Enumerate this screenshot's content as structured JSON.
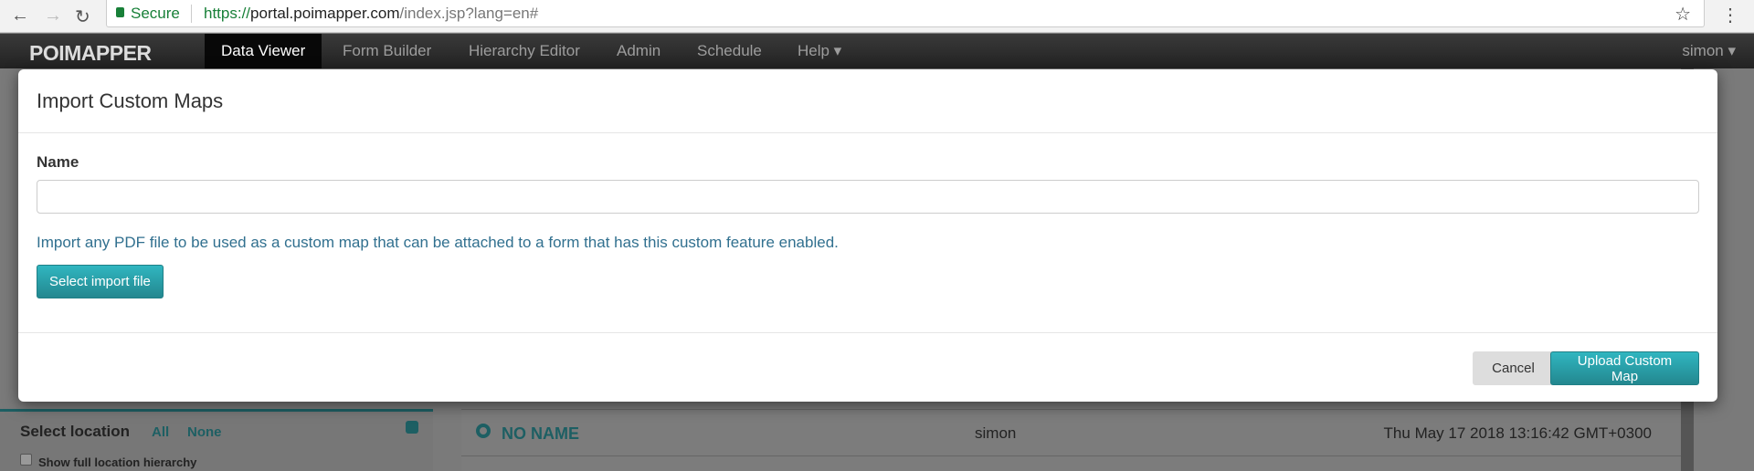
{
  "browser": {
    "secure_label": "Secure",
    "url_scheme": "https://",
    "url_host": "portal.poimapper.com",
    "url_path": "/index.jsp?lang=en#"
  },
  "navbar": {
    "logo": "POIMAPPER",
    "items": [
      {
        "label": "Data Viewer",
        "active": true
      },
      {
        "label": "Form Builder"
      },
      {
        "label": "Hierarchy Editor"
      },
      {
        "label": "Admin"
      },
      {
        "label": "Schedule"
      },
      {
        "label": "Help ▾"
      }
    ],
    "user": "simon ▾"
  },
  "modal": {
    "title": "Import Custom Maps",
    "name_label": "Name",
    "name_value": "",
    "help_text": "Import any PDF file to be used as a custom map that can be attached to a form that has this custom feature enabled.",
    "select_file": "Select import file",
    "cancel": "Cancel",
    "upload": "Upload Custom Map"
  },
  "sidebar": {
    "title": "Select location",
    "all": "All",
    "none": "None",
    "show_full": "Show full location hierarchy"
  },
  "list": {
    "rows": [
      {
        "name": "NO NAME",
        "user": "simon",
        "date": "Thu May 17 2018 13:16:42 GMT+0300"
      }
    ]
  },
  "colors": {
    "accent": "#2aa3ac",
    "link": "#31708f",
    "navbar": "#222222"
  }
}
